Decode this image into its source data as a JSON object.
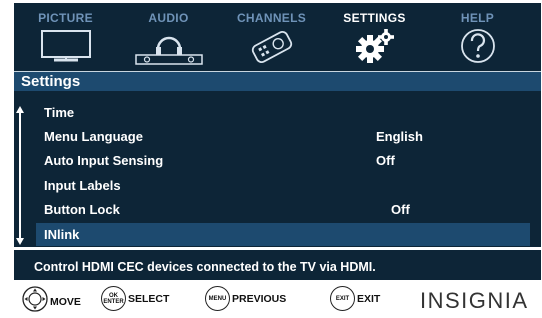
{
  "tabs": [
    {
      "label": "PICTURE",
      "icon": "tv-icon"
    },
    {
      "label": "AUDIO",
      "icon": "headphones-icon"
    },
    {
      "label": "CHANNELS",
      "icon": "remote-icon"
    },
    {
      "label": "SETTINGS",
      "icon": "gears-icon"
    },
    {
      "label": "HELP",
      "icon": "question-icon"
    }
  ],
  "active_tab": "SETTINGS",
  "settings_title": "Settings",
  "menu": {
    "items": [
      {
        "label": "Time",
        "value": ""
      },
      {
        "label": "Menu Language",
        "value": "English"
      },
      {
        "label": "Auto Input Sensing",
        "value": "Off"
      },
      {
        "label": "Input Labels",
        "value": ""
      },
      {
        "label": "Button Lock",
        "value": "Off"
      },
      {
        "label": "INlink",
        "value": ""
      }
    ],
    "selected": "INlink"
  },
  "description": "Control HDMI CEC devices connected to the TV via HDMI.",
  "nav": {
    "move_label": "MOVE",
    "select_label": "SELECT",
    "ok_button_text": "OK",
    "enter_button_text": "ENTER",
    "previous_label": "PREVIOUS",
    "menu_button_text": "MENU",
    "exit_label": "EXIT",
    "exit_button_text": "EXIT"
  },
  "brand": "INSIGNIA",
  "colors": {
    "screen_bg": "#0d2537",
    "highlight": "#1d4a6f",
    "tab_inactive": "#6f93b8",
    "text": "#ffffff"
  }
}
